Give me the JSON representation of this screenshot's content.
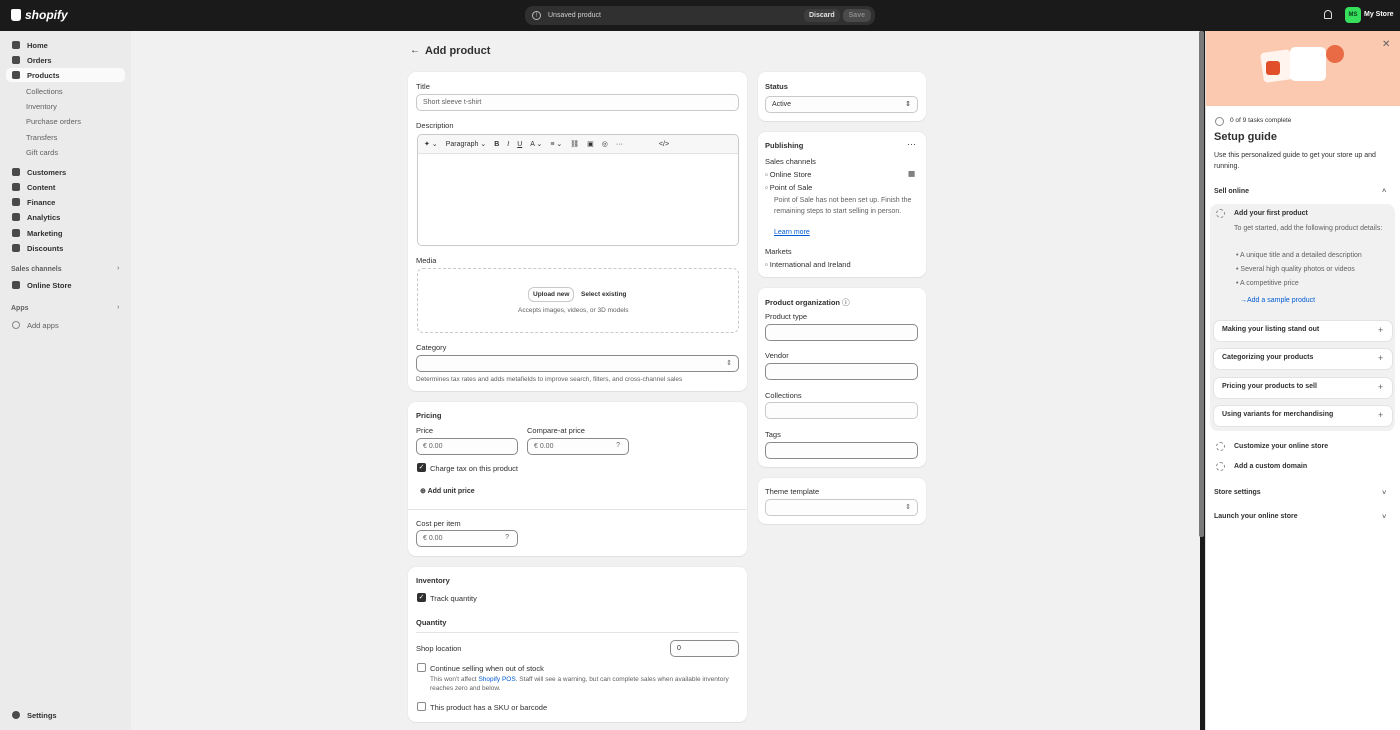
{
  "topbar": {
    "brand": "shopify",
    "unsaved": "Unsaved product",
    "discard": "Discard",
    "save": "Save",
    "avatar": "MS",
    "store": "My Store"
  },
  "sidebar": {
    "items": [
      "Home",
      "Orders",
      "Products",
      "Collections",
      "Inventory",
      "Purchase orders",
      "Transfers",
      "Gift cards",
      "Customers",
      "Content",
      "Finance",
      "Analytics",
      "Marketing",
      "Discounts"
    ],
    "sales_channels": "Sales channels",
    "online_store": "Online Store",
    "apps": "Apps",
    "add_apps": "Add apps",
    "settings": "Settings"
  },
  "page": {
    "back": "←",
    "title": "Add product"
  },
  "product": {
    "title_label": "Title",
    "title_placeholder": "Short sleeve t-shirt",
    "description_label": "Description",
    "paragraph": "Paragraph",
    "media_label": "Media",
    "upload_new": "Upload new",
    "select_existing": "Select existing",
    "media_help": "Accepts images, videos, or 3D models",
    "category_label": "Category",
    "category_help": "Determines tax rates and adds metafields to improve search, filters, and cross-channel sales"
  },
  "pricing": {
    "heading": "Pricing",
    "price_label": "Price",
    "price_value": "€  0.00",
    "compare_label": "Compare-at price",
    "compare_value": "€  0.00",
    "charge_tax": "Charge tax on this product",
    "add_unit": "Add unit price",
    "cost_label": "Cost per item",
    "cost_value": "€  0.00"
  },
  "inventory": {
    "heading": "Inventory",
    "track": "Track quantity",
    "quantity": "Quantity",
    "shop_location": "Shop location",
    "qty_value": "0",
    "continue": "Continue selling when out of stock",
    "continue_help_a": "This won't affect",
    "pos_link": "Shopify POS",
    "continue_help_b": ". Staff will see a warning, but can complete sales when available inventory reaches zero and below.",
    "sku": "This product has a SKU or barcode"
  },
  "status": {
    "heading": "Status",
    "value": "Active"
  },
  "publishing": {
    "heading": "Publishing",
    "sales_channels": "Sales channels",
    "online_store": "Online Store",
    "pos": "Point of Sale",
    "pos_help": "Point of Sale has not been set up. Finish the remaining steps to start selling in person.",
    "learn_more": "Learn more",
    "markets": "Markets",
    "market_value": "International and Ireland"
  },
  "organization": {
    "heading": "Product organization",
    "type": "Product type",
    "vendor": "Vendor",
    "collections": "Collections",
    "tags": "Tags"
  },
  "theme": {
    "heading": "Theme template"
  },
  "setup": {
    "progress": "0 of 9 tasks complete",
    "title": "Setup guide",
    "subtitle": "Use this personalized guide to get your store up and running.",
    "sell_online": "Sell online",
    "task1": "Add your first product",
    "task1_desc": "To get started, add the following product details:",
    "bullets": [
      "A unique title and a detailed description",
      "Several high quality photos or videos",
      "A competitive price"
    ],
    "add_sample": "Add a sample product",
    "accordions": [
      "Making your listing stand out",
      "Categorizing your products",
      "Pricing your products to sell",
      "Using variants for merchandising"
    ],
    "customize": "Customize your online store",
    "domain": "Add a custom domain",
    "store_settings": "Store settings",
    "launch": "Launch your online store"
  }
}
